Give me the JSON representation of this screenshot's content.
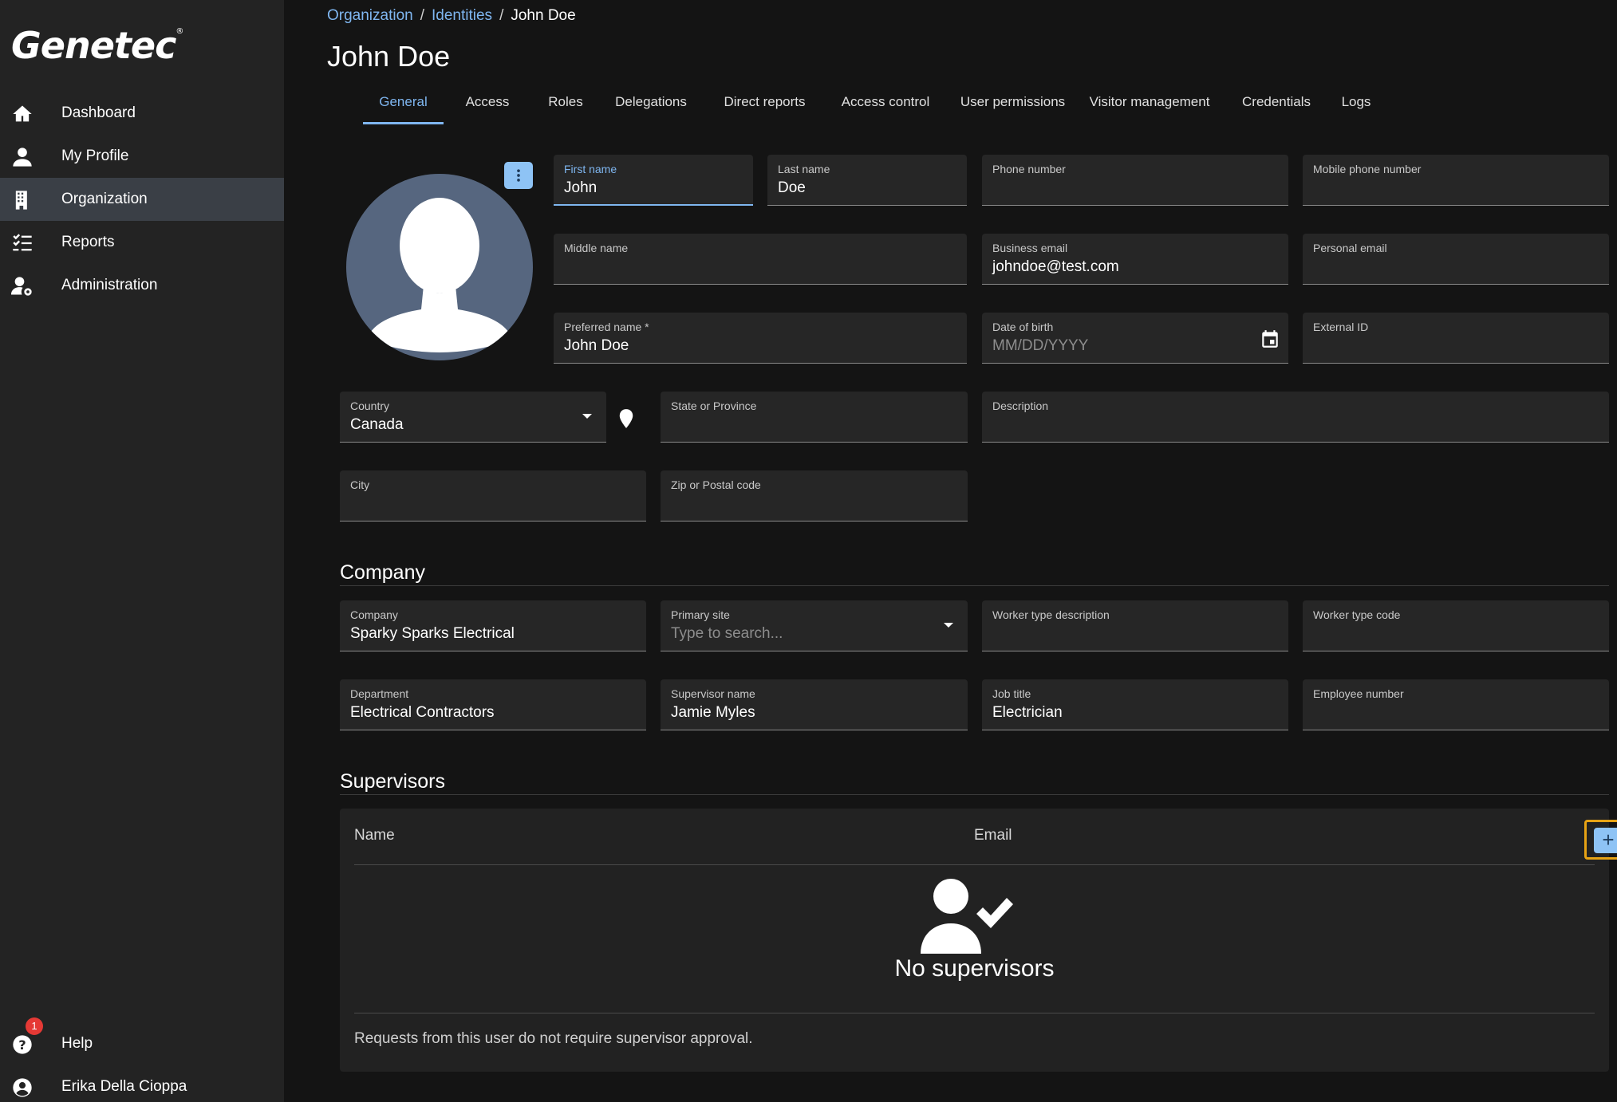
{
  "app": {
    "logo_text": "Genetec"
  },
  "sidebar": {
    "items": [
      {
        "label": "Dashboard",
        "icon": "home-icon"
      },
      {
        "label": "My Profile",
        "icon": "person-icon"
      },
      {
        "label": "Organization",
        "icon": "building-icon",
        "active": true
      },
      {
        "label": "Reports",
        "icon": "checklist-icon"
      },
      {
        "label": "Administration",
        "icon": "user-gear-icon"
      }
    ],
    "help": {
      "label": "Help",
      "badge": "1",
      "icon": "help-icon"
    },
    "user": {
      "label": "Erika Della Cioppa",
      "icon": "account-circle-icon"
    }
  },
  "breadcrumb": {
    "items": [
      "Organization",
      "Identities"
    ],
    "separator": "/",
    "current": "John Doe"
  },
  "page": {
    "title": "John Doe"
  },
  "tabs": [
    {
      "label": "General",
      "active": true
    },
    {
      "label": "Access"
    },
    {
      "label": "Roles"
    },
    {
      "label": "Delegations"
    },
    {
      "label": "Direct reports"
    },
    {
      "label": "Access control"
    },
    {
      "label": "User permissions"
    },
    {
      "label": "Visitor management"
    },
    {
      "label": "Credentials"
    },
    {
      "label": "Logs"
    }
  ],
  "general": {
    "first_name": {
      "label": "First name",
      "value": "John"
    },
    "last_name": {
      "label": "Last name",
      "value": "Doe"
    },
    "phone": {
      "label": "Phone number",
      "value": ""
    },
    "mobile": {
      "label": "Mobile phone number",
      "value": ""
    },
    "middle_name": {
      "label": "Middle name",
      "value": ""
    },
    "business_email": {
      "label": "Business email",
      "value": "johndoe@test.com"
    },
    "personal_email": {
      "label": "Personal email",
      "value": ""
    },
    "preferred_name": {
      "label": "Preferred name *",
      "value": "John Doe"
    },
    "dob": {
      "label": "Date of birth",
      "placeholder": "MM/DD/YYYY"
    },
    "external_id": {
      "label": "External ID",
      "value": ""
    },
    "country": {
      "label": "Country",
      "value": "Canada"
    },
    "state": {
      "label": "State or Province",
      "value": ""
    },
    "description": {
      "label": "Description",
      "value": ""
    },
    "city": {
      "label": "City",
      "value": ""
    },
    "zip": {
      "label": "Zip or Postal code",
      "value": ""
    }
  },
  "company_section": {
    "title": "Company",
    "company": {
      "label": "Company",
      "value": "Sparky Sparks Electrical"
    },
    "primary_site": {
      "label": "Primary site",
      "placeholder": "Type to search..."
    },
    "worker_type_desc": {
      "label": "Worker type description",
      "value": ""
    },
    "worker_type_code": {
      "label": "Worker type code",
      "value": ""
    },
    "department": {
      "label": "Department",
      "value": "Electrical Contractors"
    },
    "supervisor_name": {
      "label": "Supervisor name",
      "value": "Jamie Myles"
    },
    "job_title": {
      "label": "Job title",
      "value": "Electrician"
    },
    "employee_number": {
      "label": "Employee number",
      "value": ""
    }
  },
  "supervisors": {
    "title": "Supervisors",
    "columns": [
      "Name",
      "Email"
    ],
    "add_label": "+",
    "empty_text": "No supervisors",
    "note": "Requests from this user do not require supervisor approval."
  },
  "colors": {
    "accent": "#7fb6f0",
    "button": "#8ec3f5",
    "highlight": "#e7a314",
    "badge": "#e53935"
  }
}
